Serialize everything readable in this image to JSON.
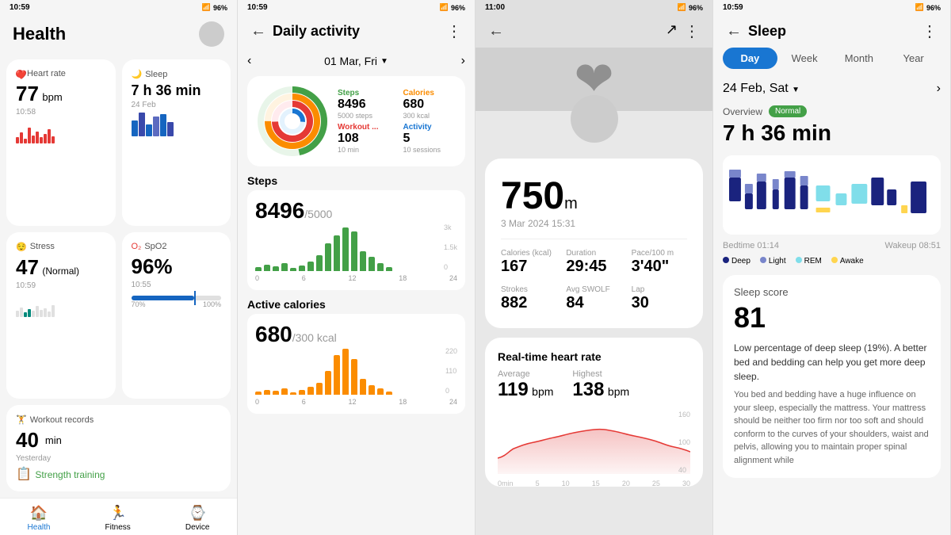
{
  "screens": {
    "health": {
      "statusBar": {
        "time": "10:59",
        "battery": "96%"
      },
      "title": "Health",
      "heartRate": {
        "label": "Heart rate",
        "value": "77",
        "unit": "bpm",
        "time": "10:58"
      },
      "sleep": {
        "label": "Sleep",
        "value": "7 h 36 min",
        "date": "24 Feb"
      },
      "stress": {
        "label": "Stress",
        "value": "47",
        "status": "(Normal)",
        "time": "10:59"
      },
      "spo2": {
        "label": "SpO2",
        "value": "96%",
        "time": "10:55"
      },
      "workout": {
        "label": "Workout records",
        "value": "40",
        "unit": "min",
        "date": "Yesterday",
        "subLabel": "Strength training"
      },
      "nav": {
        "health": "Health",
        "fitness": "Fitness",
        "device": "Device"
      }
    },
    "dailyActivity": {
      "statusBar": {
        "time": "10:59",
        "battery": "96%"
      },
      "title": "Daily activity",
      "date": "01 Mar, Fri",
      "rings": {
        "steps": {
          "label": "Steps",
          "value": "8496",
          "sub": "5000 steps",
          "color": "#43a047"
        },
        "calories": {
          "label": "Calories",
          "value": "680",
          "sub": "300 kcal",
          "color": "#fb8c00"
        },
        "workout": {
          "label": "Workout ...",
          "value": "108",
          "sub": "10 min",
          "color": "#e53935"
        },
        "activity": {
          "label": "Activity",
          "value": "5",
          "sub": "10 sessions",
          "color": "#1976d2"
        }
      },
      "stepsSection": {
        "title": "Steps",
        "value": "8496",
        "target": "/5000",
        "chartYMax": "3k",
        "chartYMid": "1.5k",
        "chartLabels": [
          "0",
          "6",
          "12",
          "18",
          "24"
        ]
      },
      "caloriesSection": {
        "title": "Active calories",
        "value": "680",
        "target": "/300 kcal",
        "chartYMax": "220",
        "chartYMid": "110",
        "chartLabels": [
          "0",
          "6",
          "12",
          "18",
          "24"
        ]
      }
    },
    "activity": {
      "statusBar": {
        "time": "11:00",
        "battery": "96%"
      },
      "distance": "750",
      "distUnit": "m",
      "date": "3 Mar 2024 15:31",
      "stats": [
        {
          "label": "Calories (kcal)",
          "value": "167"
        },
        {
          "label": "Duration",
          "value": "29:45"
        },
        {
          "label": "Pace/100 m",
          "value": "3'40\""
        },
        {
          "label": "Strokes",
          "value": "882"
        },
        {
          "label": "Avg SWOLF",
          "value": "84"
        },
        {
          "label": "Lap",
          "value": "30"
        }
      ],
      "heartRate": {
        "title": "Real-time heart rate",
        "average": {
          "label": "Average",
          "value": "119",
          "unit": "bpm"
        },
        "highest": {
          "label": "Highest",
          "value": "138",
          "unit": "bpm"
        }
      }
    },
    "sleep": {
      "statusBar": {
        "time": "10:59",
        "battery": "96%"
      },
      "title": "Sleep",
      "tabs": [
        "Day",
        "Week",
        "Month",
        "Year"
      ],
      "activeTab": "Day",
      "date": "24 Feb, Sat",
      "overview": {
        "label": "Overview",
        "status": "Normal"
      },
      "totalSleep": "7 h 36 min",
      "bedtime": "Bedtime 01:14",
      "wakeup": "Wakeup 08:51",
      "legend": [
        {
          "label": "Deep",
          "color": "#1a237e"
        },
        {
          "label": "Light",
          "color": "#7986cb"
        },
        {
          "label": "REM",
          "color": "#80deea"
        },
        {
          "label": "Awake",
          "color": "#ffd54f"
        }
      ],
      "scoreSection": {
        "title": "Sleep score",
        "value": "81",
        "highlight": "Low percentage of deep sleep (19%). A better bed and bedding can help you get more deep sleep.",
        "detail": "You bed and bedding have a huge influence on your sleep, especially the mattress. Your mattress should be neither too firm nor too soft and should conform to the curves of your shoulders, waist and pelvis, allowing you to maintain proper spinal alignment while"
      }
    }
  }
}
